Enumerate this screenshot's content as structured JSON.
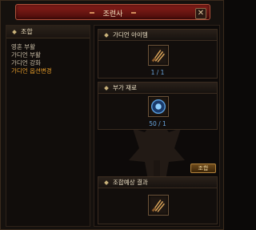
{
  "window": {
    "title": "조련사",
    "close_glyph": "✕"
  },
  "sidebar": {
    "header": "조합",
    "items": [
      {
        "label": "영혼 부활",
        "active": false
      },
      {
        "label": "가디언 부활",
        "active": false
      },
      {
        "label": "가디언 강화",
        "active": false
      },
      {
        "label": "가디언 옵션변경",
        "active": true
      }
    ]
  },
  "panels": {
    "guardian_item": {
      "title": "가디언 아이템",
      "count": "1 / 1",
      "icon": "claw-weapon-icon"
    },
    "extra_material": {
      "title": "부가 재료",
      "count": "50 / 1",
      "icon": "blue-orb-icon"
    },
    "result": {
      "title": "조합예상 결과",
      "icon": "claw-weapon-icon"
    }
  },
  "combine_button": {
    "label": "조합"
  },
  "colors": {
    "accent": "#e49b2a",
    "count": "#6aa7e0",
    "title_bar": "#8a1f1a"
  }
}
